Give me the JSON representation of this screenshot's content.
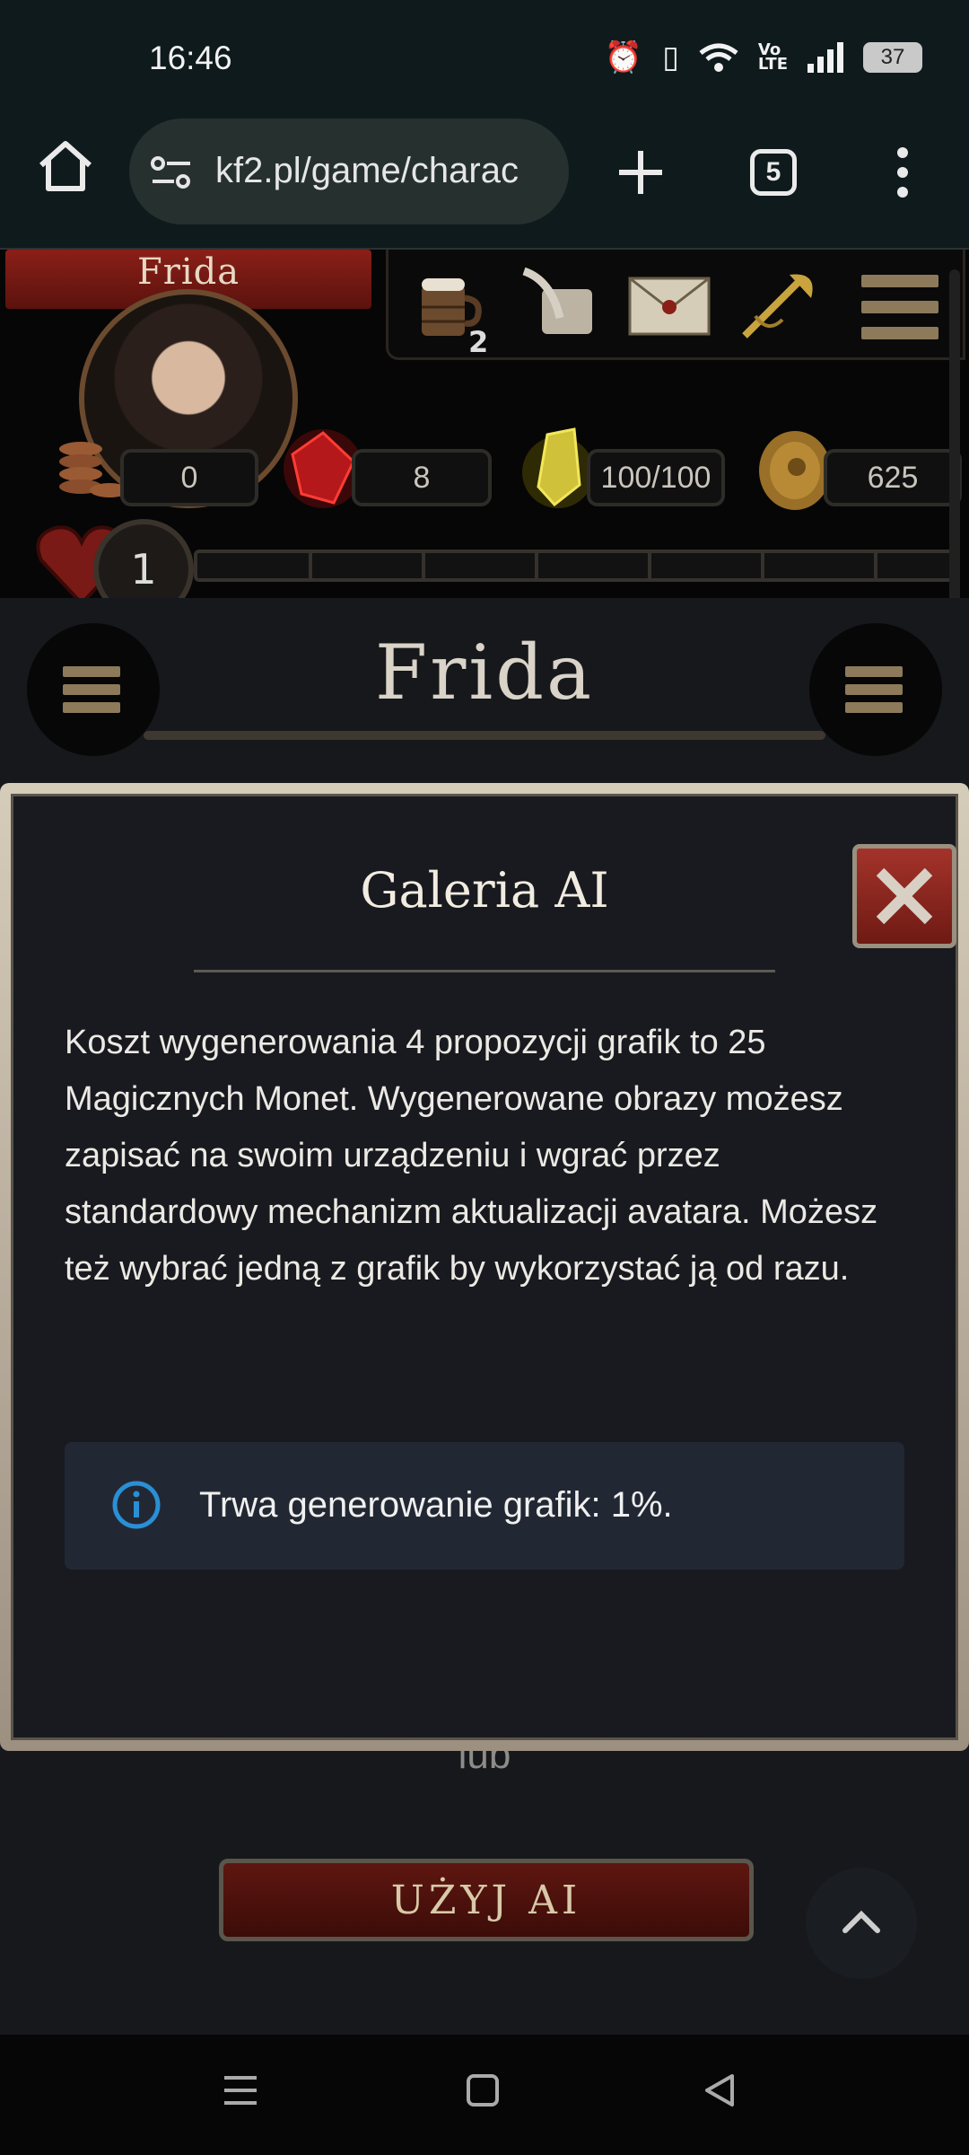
{
  "status_bar": {
    "time": "16:46",
    "battery": "37",
    "icons": [
      "alarm-icon",
      "vibrate-icon",
      "wifi-icon",
      "volte-icon",
      "signal-icon",
      "battery-icon"
    ]
  },
  "browser": {
    "url": "kf2.pl/game/charac",
    "tab_count": "5"
  },
  "game_header": {
    "character_name": "Frida",
    "mug_count": "2",
    "resources": {
      "copper": "0",
      "gems": "8",
      "energy": "100/100",
      "gold": "625"
    },
    "level": "1"
  },
  "page": {
    "character_title": "Frida",
    "or_text": "lub",
    "use_ai_button": "UŻYJ AI"
  },
  "modal": {
    "title": "Galeria AI",
    "body": "Koszt wygenerowania 4 propozycji grafik to 25 Magicznych Monet. Wygenerowane obrazy możesz zapisać na swoim urządzeniu i wgrać przez standardowy mechanizm aktualizacji avatara. Możesz też wybrać jedną z grafik by wykorzystać ją od razu.",
    "info": "Trwa generowanie grafik: 1%.",
    "generation_progress": 1
  },
  "colors": {
    "accent_red": "#8a1f18",
    "info_blue": "#2a8fd6",
    "panel": "#181a1f"
  }
}
